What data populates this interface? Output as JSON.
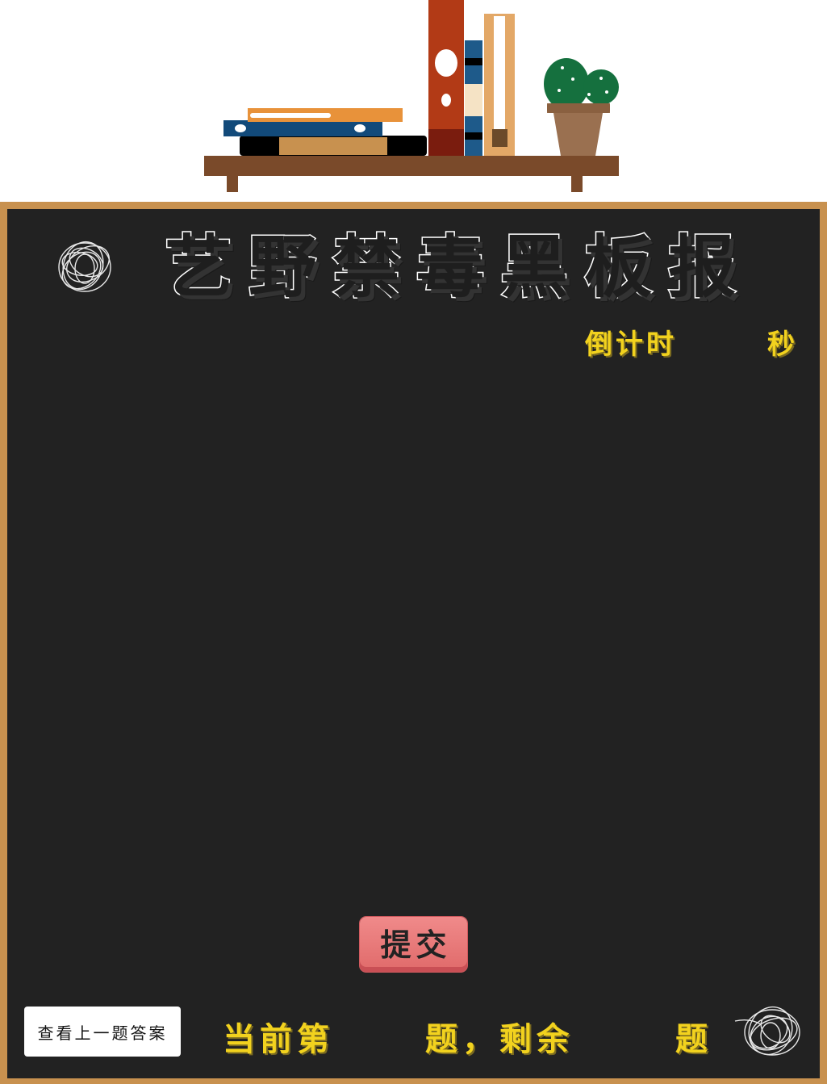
{
  "header": {
    "title": "艺野禁毒黑板报"
  },
  "timer": {
    "label": "倒计时",
    "value": "",
    "unit": "秒"
  },
  "actions": {
    "submit_label": "提交",
    "prev_answer_label": "查看上一题答案"
  },
  "progress": {
    "prefix": "当前第",
    "current": "",
    "middle": "题，剩余",
    "remaining": "",
    "suffix": "题"
  },
  "colors": {
    "board_frame": "#c8914f",
    "board_surface": "#222222",
    "accent_yellow": "#f2d21e",
    "submit_button": "#e87478"
  }
}
